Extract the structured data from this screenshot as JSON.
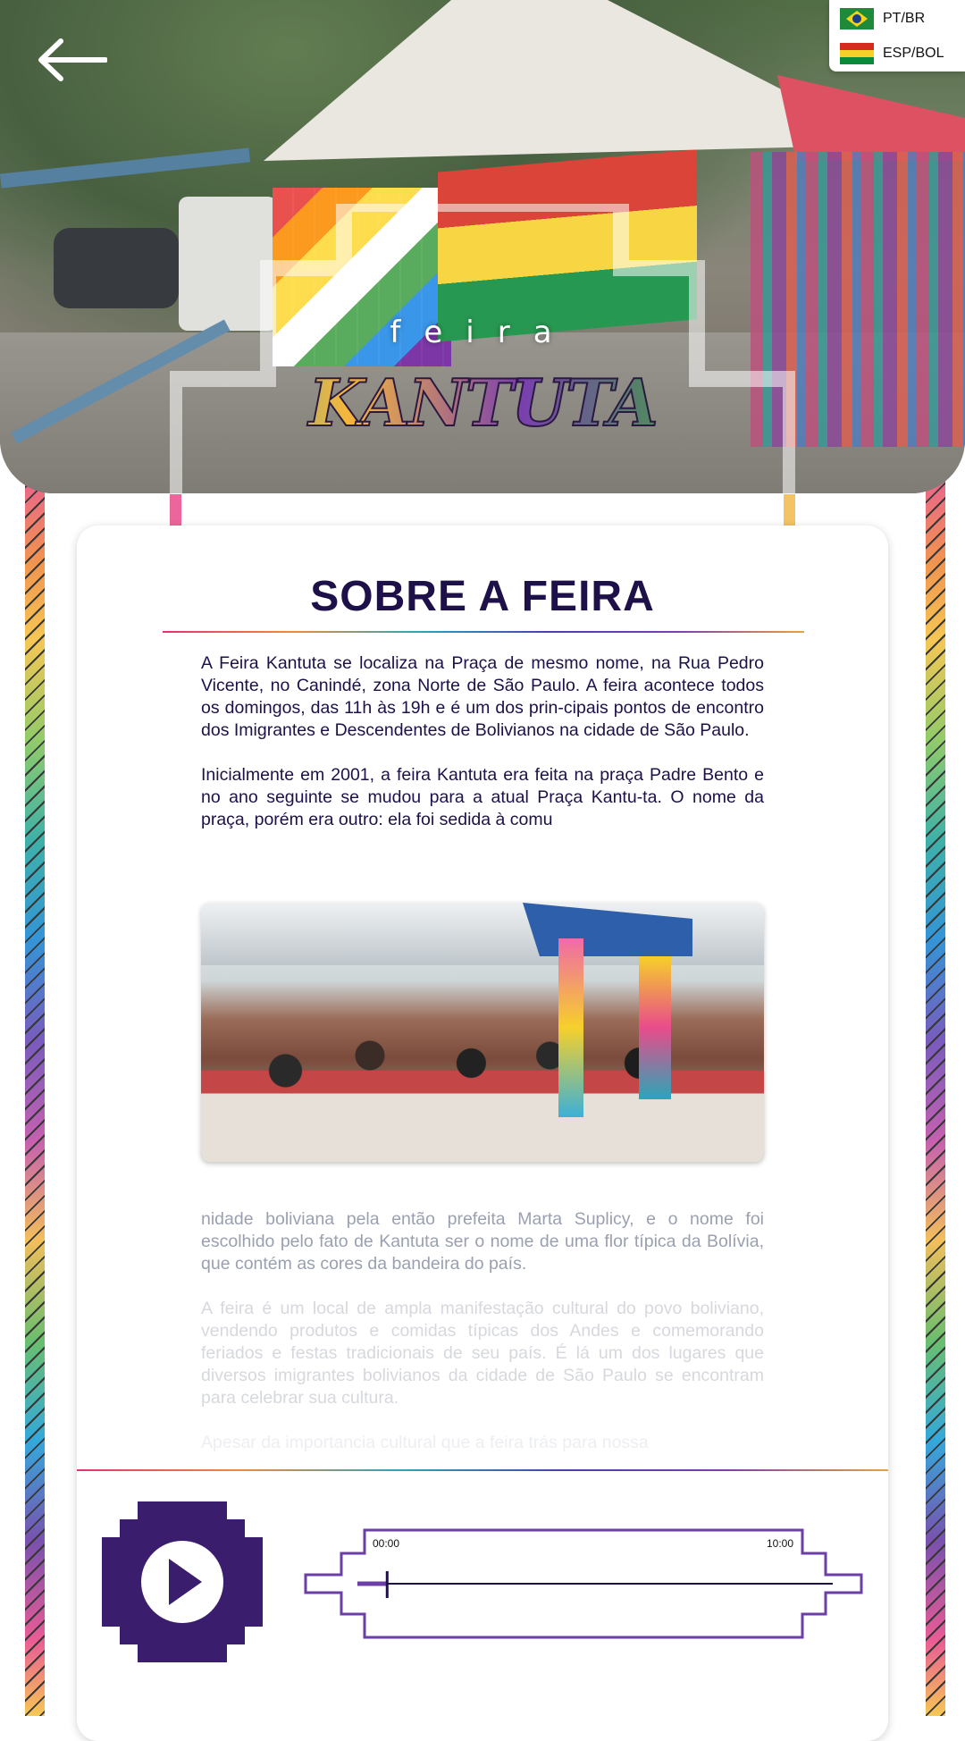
{
  "header": {
    "logo_small": "feira",
    "logo_main": "KANTUTA",
    "languages": [
      {
        "code": "PT/BR",
        "flag": "brazil-flag"
      },
      {
        "code": "ESP/BOL",
        "flag": "bolivia-flag"
      }
    ]
  },
  "article": {
    "title": "SOBRE A FEIRA",
    "paragraphs_top": [
      "A Feira Kantuta se localiza na Praça de mesmo nome, na Rua Pedro Vicente, no Canindé, zona Norte de São Paulo. A feira acontece todos os domingos, das 11h às 19h e é um dos prin-cipais pontos de encontro dos Imigrantes e Descendentes de Bolivianos na cidade de São Paulo.",
      "Inicialmente em 2001, a feira Kantuta era feita na praça Padre Bento e no ano seguinte se mudou para a atual Praça Kantu-ta. O nome da praça, porém era outro: ela foi sedida à comu"
    ],
    "paragraphs_bottom": [
      "nidade boliviana pela então prefeita Marta Suplicy, e o nome foi escolhido pelo fato de Kantuta ser o nome de uma flor típica da Bolívia, que contém as cores da bandeira do país.",
      "A feira é um local de ampla manifestação cultural do povo boliviano, vendendo produtos e comidas típicas dos Andes e comemorando feriados e festas tradicionais de seu país. É lá um dos lugares que diversos imigrantes bolivianos da cidade de São Paulo se encontram para celebrar sua cultura.",
      "Apesar da importancia cultural que a feira trás para nossa"
    ]
  },
  "player": {
    "time_start": "00:00",
    "time_end": "10:00",
    "progress": 0.04
  },
  "colors": {
    "title": "#1e1048",
    "accent_purple": "#3b1d6e",
    "bolivia": [
      "#d52b1e",
      "#f7d02a",
      "#0a8a3a"
    ]
  }
}
